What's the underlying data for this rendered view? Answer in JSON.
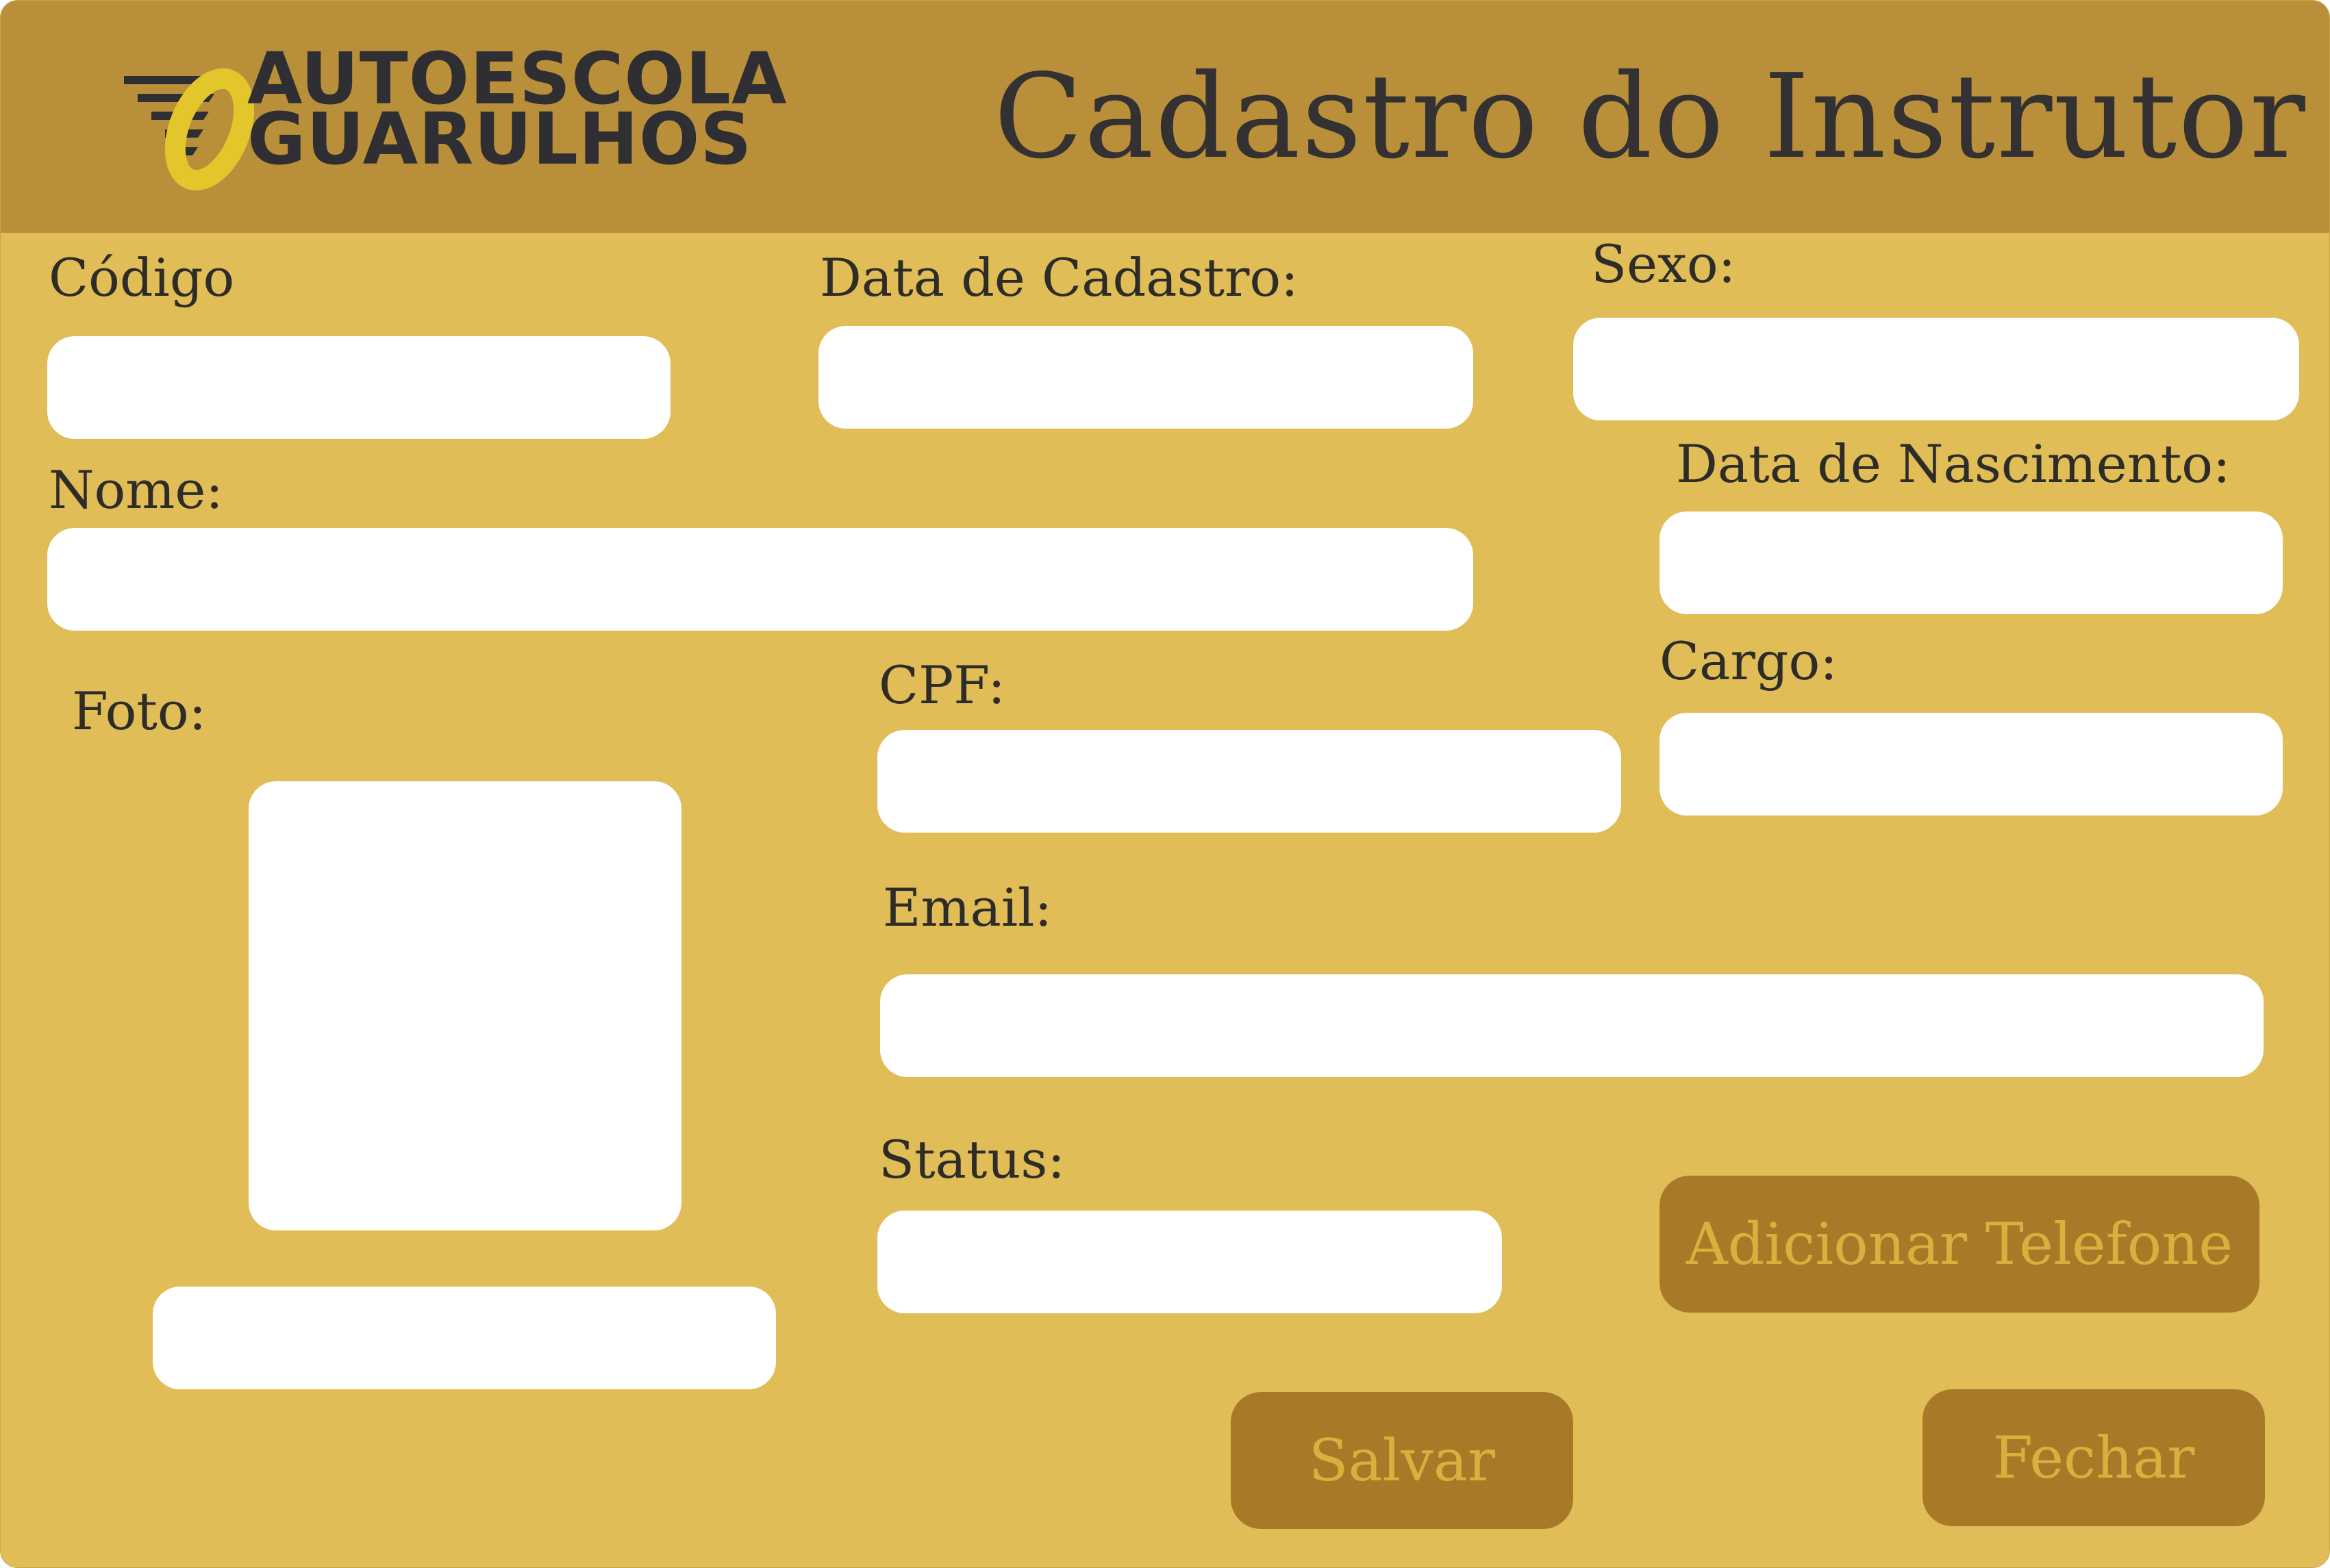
{
  "window": {
    "title": "Cadastro do Instrutor"
  },
  "logo": {
    "line1": "AUTOESCOLA",
    "line2": "GUARULHOS"
  },
  "form": {
    "codigo_label": "Código",
    "data_cadastro_label": "Data de Cadastro:",
    "sexo_label": "Sexo:",
    "nome_label": "Nome:",
    "data_nascimento_label": "Data de Nascimento:",
    "foto_label": "Foto:",
    "cpf_label": "CPF:",
    "cargo_label": "Cargo:",
    "email_label": "Email:",
    "status_label": "Status:"
  },
  "buttons": {
    "adicionar_telefone": "Adicionar Telefone",
    "salvar": "Salvar",
    "fechar": "Fechar"
  },
  "colors": {
    "background": "#e0bd56",
    "header": "#b99039",
    "button": "#a87a28",
    "button_text": "#d6b13e",
    "logo_accent": "#e3c62b"
  }
}
